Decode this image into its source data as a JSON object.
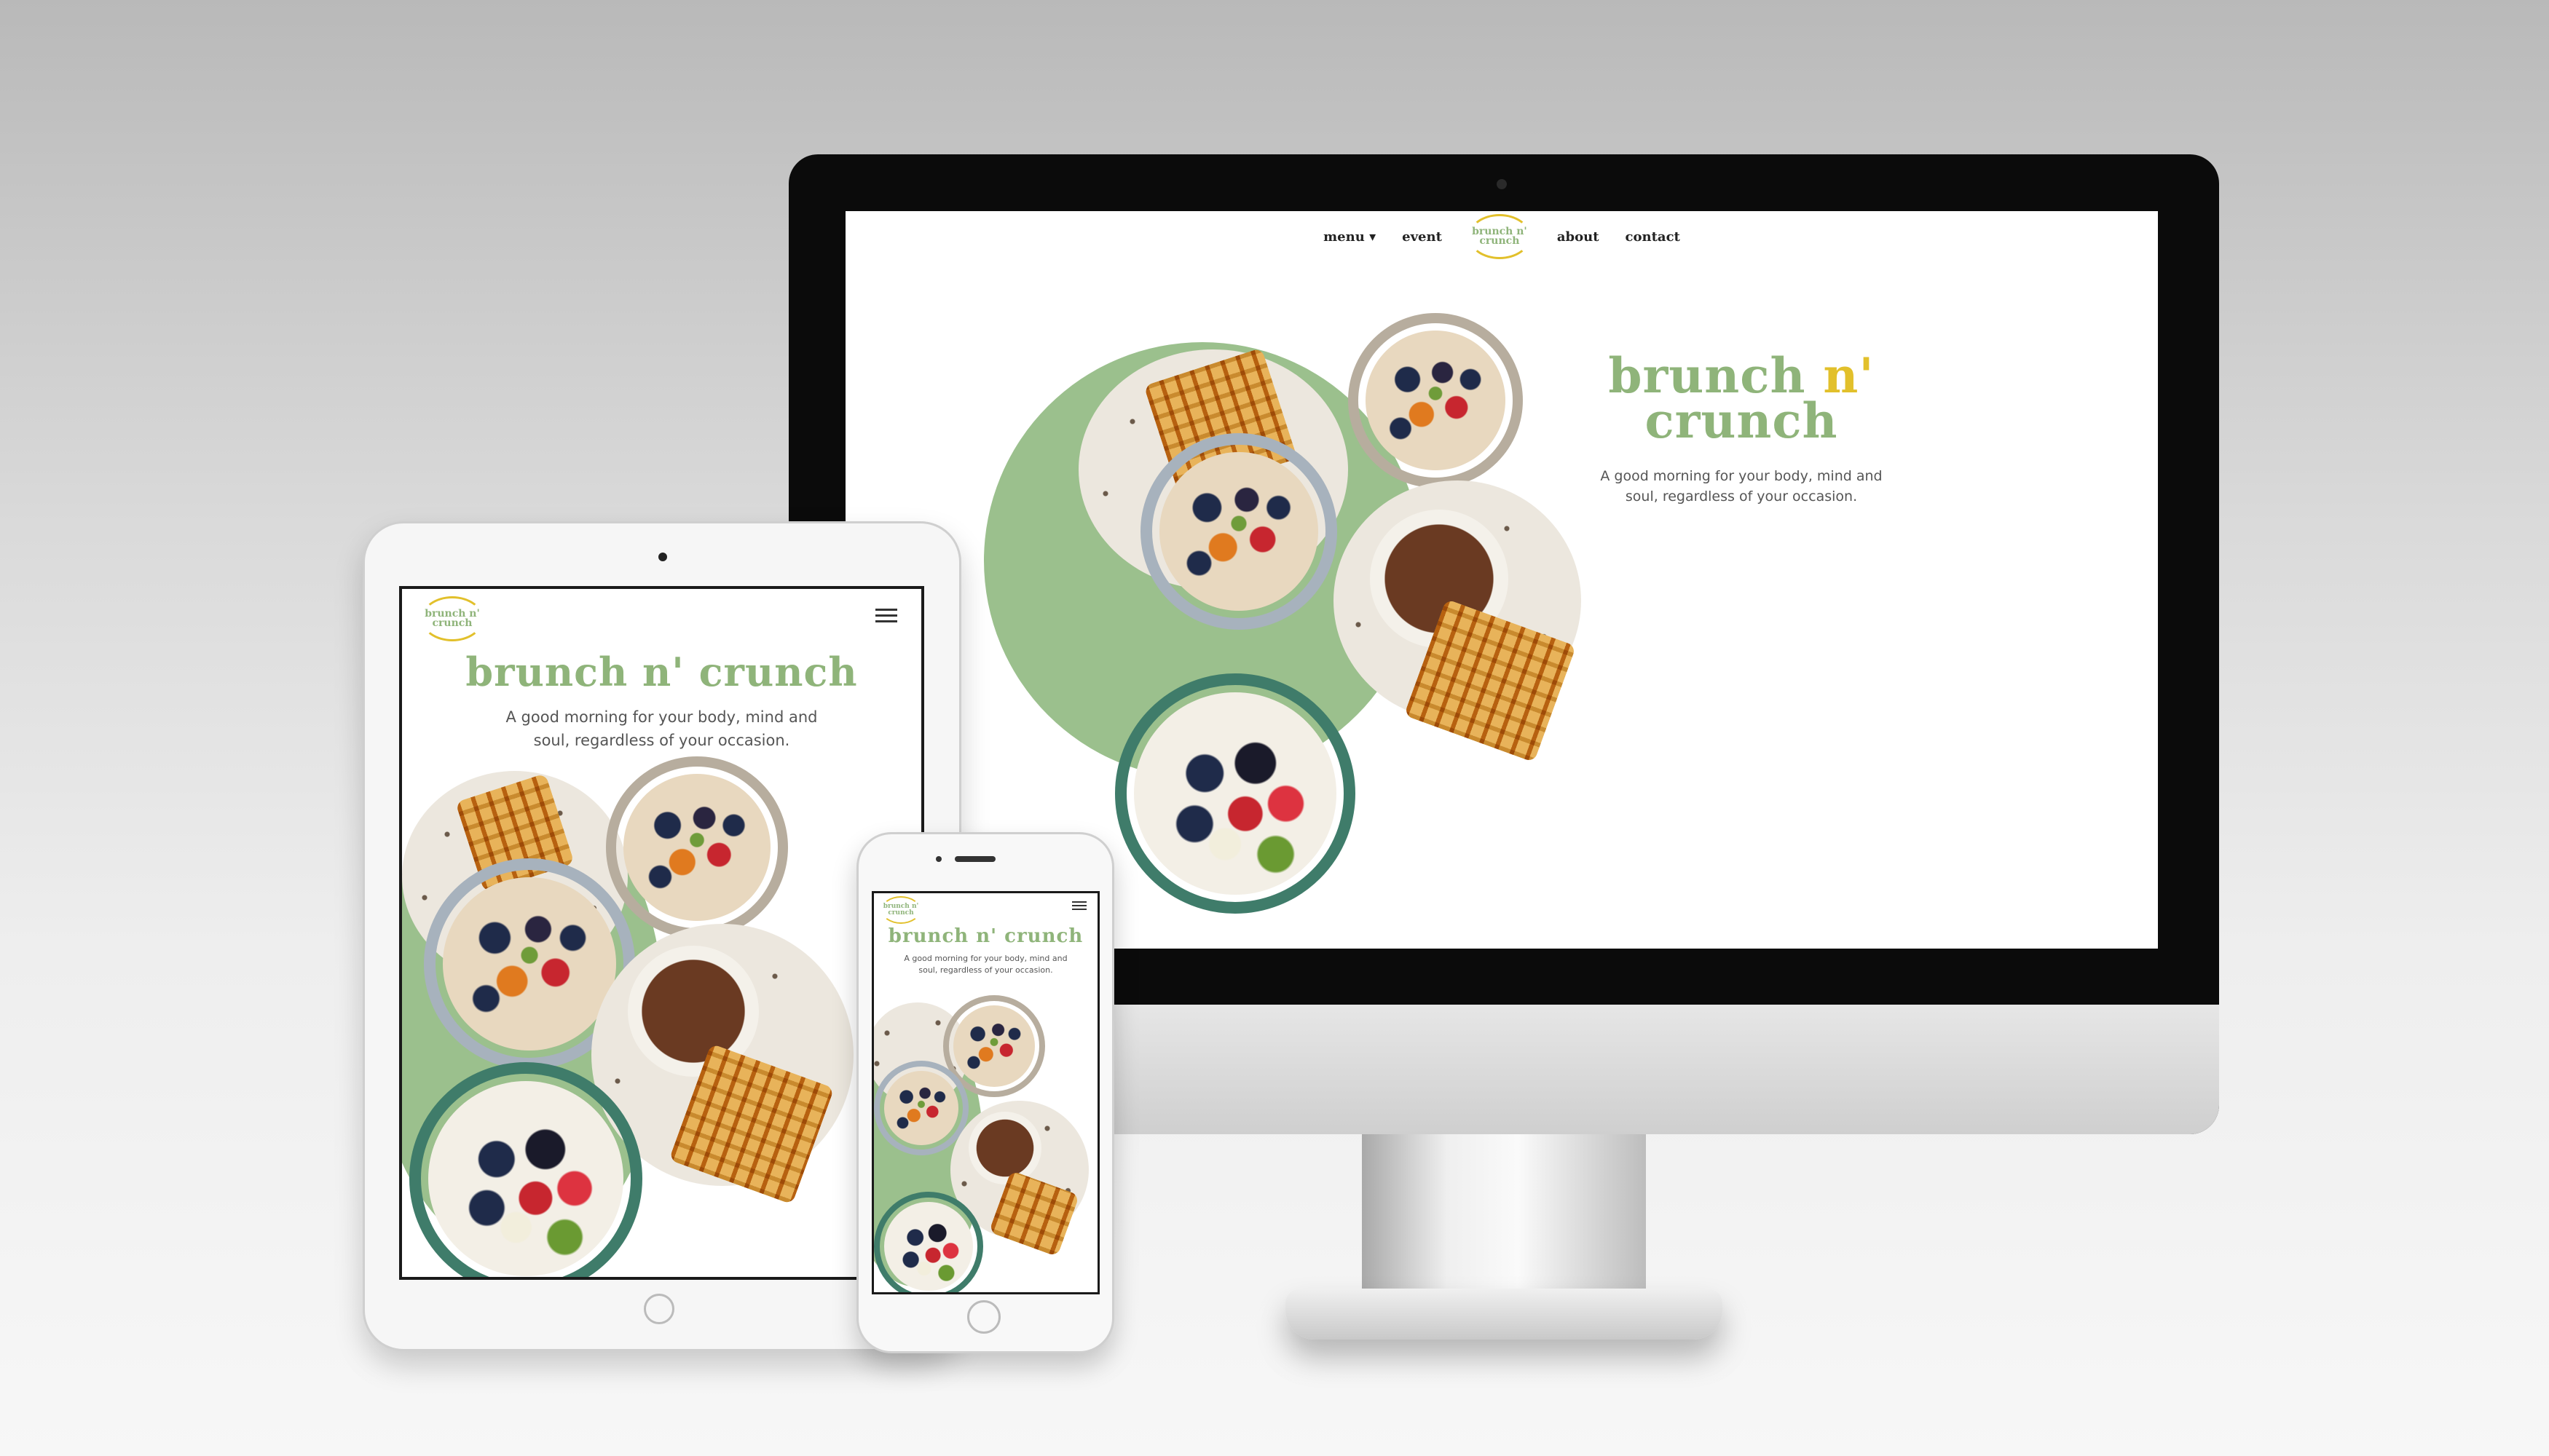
{
  "theme": {
    "brand_green": "#8fb47a",
    "brand_yellow": "#e2c02b",
    "circle_green": "#9bc08d"
  },
  "brand": {
    "name_part1": "brunch",
    "name_accent": "n'",
    "name_part2": "crunch",
    "full_name": "brunch n' crunch",
    "logo_line1": "brunch n'",
    "logo_line2": "crunch"
  },
  "tagline": "A good morning for your body, mind and soul, regardless of your occasion.",
  "desktop": {
    "nav": {
      "menu": "menu",
      "event": "event",
      "about": "about",
      "contact": "contact"
    },
    "tagline_line1": "A good morning for your body, mind and",
    "tagline_line2": "soul, regardless of your occasion."
  },
  "tablet": {
    "tagline_line1": "A good morning for your body, mind and",
    "tagline_line2": "soul, regardless of your occasion.",
    "menu_icon": "hamburger-icon"
  },
  "phone": {
    "tagline_line1": "A good morning for your body, mind and",
    "tagline_line2": "soul, regardless of your occasion.",
    "menu_icon": "hamburger-icon"
  }
}
